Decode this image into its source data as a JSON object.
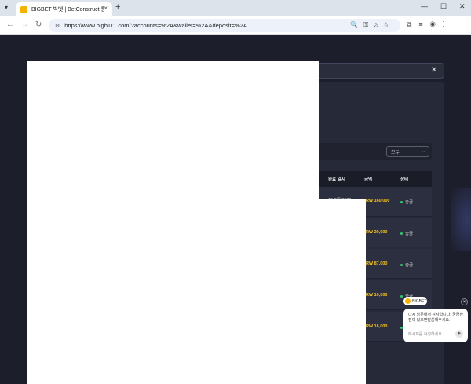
{
  "browser": {
    "tab_title": "BIGBET 빅벳 | BetConstruct 통",
    "tab_close": "×",
    "new_tab": "+",
    "minimize": "—",
    "maximize": "☐",
    "close": "✕",
    "url": "https://www.bigb111.com/?accounts=%2A&wallet=%2A&deposit=%2A"
  },
  "panel": {
    "close_label": "✕"
  },
  "filter": {
    "selected": "모두"
  },
  "table": {
    "headers": [
      "완료 일시",
      "금액",
      "상태"
    ],
    "rows": [
      {
        "date": "16/8월/2026",
        "amount": "KRW 160,000",
        "status": "승금"
      },
      {
        "date": "",
        "amount": "KRW 20,000",
        "status": "승금"
      },
      {
        "date": "",
        "amount": "KRW 87,000",
        "status": "승금"
      },
      {
        "date": "",
        "amount": "KRW 10,000",
        "status": "승금"
      },
      {
        "date": "",
        "amount": "KRW 16,000",
        "status": "승금"
      }
    ]
  },
  "chat": {
    "badge": "BIGBET",
    "close": "×",
    "message": "다시 방문해서 감사합니다. 궁금한점이 있으면말씀해주세요.",
    "placeholder": "메시지를 작성하세요...",
    "send": "➤"
  },
  "colors": {
    "accent": "#f6c21c",
    "status_ok": "#2ecc71",
    "background": "#1c1e2b"
  }
}
